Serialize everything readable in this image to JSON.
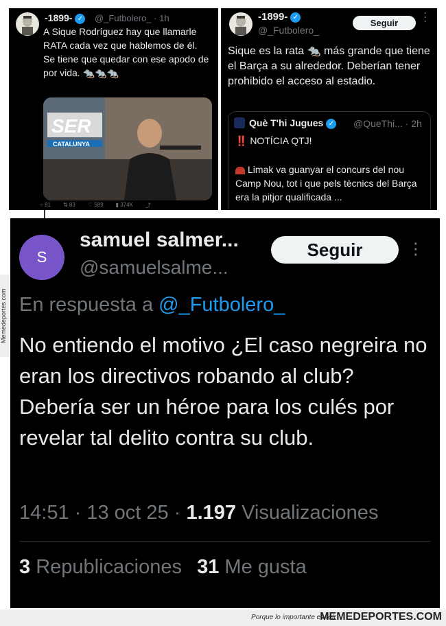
{
  "tweet1": {
    "name": "-1899-",
    "handle": "@_Futbolero_ · 1h",
    "text": "A Sique Rodríguez hay que llamarle RATA cada vez que hablemos de él. Se tiene que quedar con ese apodo de por vida.",
    "rats": "🐀🐀🐀",
    "photo_logo": "SER",
    "photo_sublogo": "CATALUNYA",
    "stats": [
      "81",
      "83",
      "589",
      "374K"
    ]
  },
  "tweet2": {
    "name": "-1899-",
    "handle": "@_Futbolero_",
    "follow": "Seguir",
    "text_a": "Sique es la rata",
    "rat": "🐀",
    "text_b": "más grande que tiene el Barça a su alrededor. Deberían tener prohibido el acceso al estadio.",
    "quote": {
      "name": "Què T'hi Jugues",
      "handle": "@QueThi... · 2h",
      "line1": "‼️ NOTÍCIA QTJ!",
      "line2": "Limak va guanyar el concurs del nou Camp Nou, tot i que pels tècnics del Barça era la pitjor qualificada   ..."
    }
  },
  "tweet3": {
    "avatar_letter": "S",
    "name": "samuel salmer...",
    "handle": "@samuelsalme...",
    "follow": "Seguir",
    "reply_prefix": "En respuesta a",
    "reply_to": "@_Futbolero_",
    "text": "No entiendo el motivo ¿El caso negreira no eran los directivos robando al club? Debería ser un héroe para los culés por revelar tal delito contra su club.",
    "time": "14:51 · 13 oct 25 ·",
    "views_count": "1.197",
    "views_label": "Visualizaciones",
    "reposts_count": "3",
    "reposts_label": "Republicaciones",
    "likes_count": "31",
    "likes_label": "Me gusta"
  },
  "watermark": {
    "side": "Memedeportes.com",
    "slogan": "Porque lo importante es reír",
    "brand": "MEMEDEPORTES.COM"
  },
  "colors": {
    "background": "#000000",
    "text": "#e7e9ea",
    "muted": "#71767b",
    "link": "#1d9bf0",
    "avatar": "#7856c9"
  }
}
